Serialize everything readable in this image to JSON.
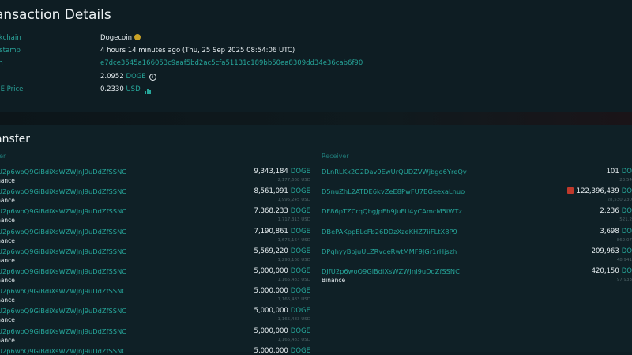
{
  "details": {
    "title": "ansaction Details",
    "rows": [
      {
        "label": "ckchain",
        "value": "Dogecoin",
        "icon": "dogecoin-icon"
      },
      {
        "label": "estamp",
        "value": "4 hours 14 minutes ago (Thu, 25 Sep 2025 08:54:06 UTC)"
      },
      {
        "label": "sh",
        "value": "e7dce3545a166053c9aaf5bd2ac5cfa51131c189bb50ea8309dd34e36cab6f90"
      },
      {
        "label": "",
        "value": "2.0952",
        "unit": "DOGE",
        "icon": "info-icon"
      },
      {
        "label": "GE Price",
        "value": "0.2330",
        "unit": "USD",
        "icon": "price-chart-icon"
      }
    ]
  },
  "transfer": {
    "title": "ansfer",
    "sender_header": "der",
    "receiver_header": "Receiver",
    "senders": [
      {
        "address": "fU2p6woQ9GiBdiXsWZWJnJ9uDdZfSSNC",
        "entity": "inance",
        "amount": "9,343,184",
        "unit": "DOGE",
        "usd": "2,177,668 USD"
      },
      {
        "address": "fU2p6woQ9GiBdiXsWZWJnJ9uDdZfSSNC",
        "entity": "inance",
        "amount": "8,561,091",
        "unit": "DOGE",
        "usd": "1,995,245 USD"
      },
      {
        "address": "fU2p6woQ9GiBdiXsWZWJnJ9uDdZfSSNC",
        "entity": "inance",
        "amount": "7,368,233",
        "unit": "DOGE",
        "usd": "1,717,313 USD"
      },
      {
        "address": "fU2p6woQ9GiBdiXsWZWJnJ9uDdZfSSNC",
        "entity": "inance",
        "amount": "7,190,861",
        "unit": "DOGE",
        "usd": "1,676,164 USD"
      },
      {
        "address": "fU2p6woQ9GiBdiXsWZWJnJ9uDdZfSSNC",
        "entity": "inance",
        "amount": "5,569,220",
        "unit": "DOGE",
        "usd": "1,298,168 USD"
      },
      {
        "address": "fU2p6woQ9GiBdiXsWZWJnJ9uDdZfSSNC",
        "entity": "inance",
        "amount": "5,000,000",
        "unit": "DOGE",
        "usd": "1,165,483 USD"
      },
      {
        "address": "fU2p6woQ9GiBdiXsWZWJnJ9uDdZfSSNC",
        "entity": "inance",
        "amount": "5,000,000",
        "unit": "DOGE",
        "usd": "1,165,483 USD"
      },
      {
        "address": "fU2p6woQ9GiBdiXsWZWJnJ9uDdZfSSNC",
        "entity": "inance",
        "amount": "5,000,000",
        "unit": "DOGE",
        "usd": "1,165,483 USD"
      },
      {
        "address": "fU2p6woQ9GiBdiXsWZWJnJ9uDdZfSSNC",
        "entity": "inance",
        "amount": "5,000,000",
        "unit": "DOGE",
        "usd": "1,165,483 USD"
      },
      {
        "address": "fU2p6woQ9GiBdiXsWZWJnJ9uDdZfSSNC",
        "entity": "",
        "amount": "5,000,000",
        "unit": "DOGE",
        "usd": ""
      }
    ],
    "receivers": [
      {
        "address": "DLnRLKx2G2Dav9EwUrQUDZVWjbgo6YreQv",
        "entity": "",
        "amount": "101",
        "unit": "DO",
        "usd": "23.54",
        "warn": false
      },
      {
        "address": "D5nuZhL2ATDE6kvZeE8PwFU7BGeexaLnuo",
        "entity": "",
        "amount": "122,396,439",
        "unit": "DO",
        "usd": "28,530,230",
        "warn": true
      },
      {
        "address": "DF86pTZCrqQbgJpEh9JuFU4yCAmcM5iWTz",
        "entity": "",
        "amount": "2,236",
        "unit": "DO",
        "usd": "521.2",
        "warn": false
      },
      {
        "address": "DBePAKppELcFb26DDzXzeKHZ7iiFLtX8P9",
        "entity": "",
        "amount": "3,698",
        "unit": "DO",
        "usd": "862.07",
        "warn": false
      },
      {
        "address": "DPqhyyBpjuULZRvdeRwtMMF9JGr1rHjszh",
        "entity": "",
        "amount": "209,963",
        "unit": "DO",
        "usd": "48,941",
        "warn": false
      },
      {
        "address": "DJfU2p6woQ9GiBdiXsWZWJnJ9uDdZfSSNC",
        "entity": "Binance",
        "amount": "420,150",
        "unit": "DO",
        "usd": "97,933",
        "warn": false
      }
    ]
  }
}
